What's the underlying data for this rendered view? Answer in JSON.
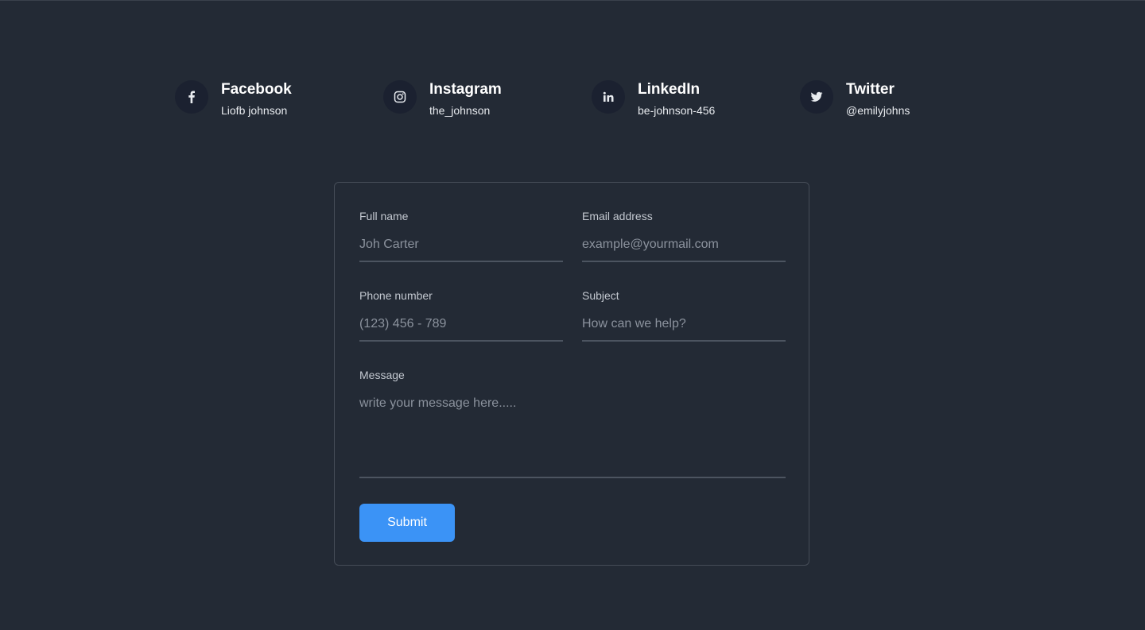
{
  "socials": [
    {
      "name": "Facebook",
      "handle": "Liofb johnson",
      "icon": "facebook-icon"
    },
    {
      "name": "Instagram",
      "handle": "the_johnson",
      "icon": "instagram-icon"
    },
    {
      "name": "LinkedIn",
      "handle": "be-johnson-456",
      "icon": "linkedin-icon"
    },
    {
      "name": "Twitter",
      "handle": "@emilyjohns",
      "icon": "twitter-icon"
    }
  ],
  "form": {
    "full_name": {
      "label": "Full name",
      "placeholder": "Joh Carter",
      "value": ""
    },
    "email": {
      "label": "Email address",
      "placeholder": "example@yourmail.com",
      "value": ""
    },
    "phone": {
      "label": "Phone number",
      "placeholder": "(123) 456 - 789",
      "value": ""
    },
    "subject": {
      "label": "Subject",
      "placeholder": "How can we help?",
      "value": ""
    },
    "message": {
      "label": "Message",
      "placeholder": "write your message here.....",
      "value": ""
    },
    "submit_label": "Submit"
  },
  "colors": {
    "background": "#232a35",
    "icon_circle": "#1b2130",
    "accent": "#3b93f6",
    "card_border": "#454c57"
  }
}
